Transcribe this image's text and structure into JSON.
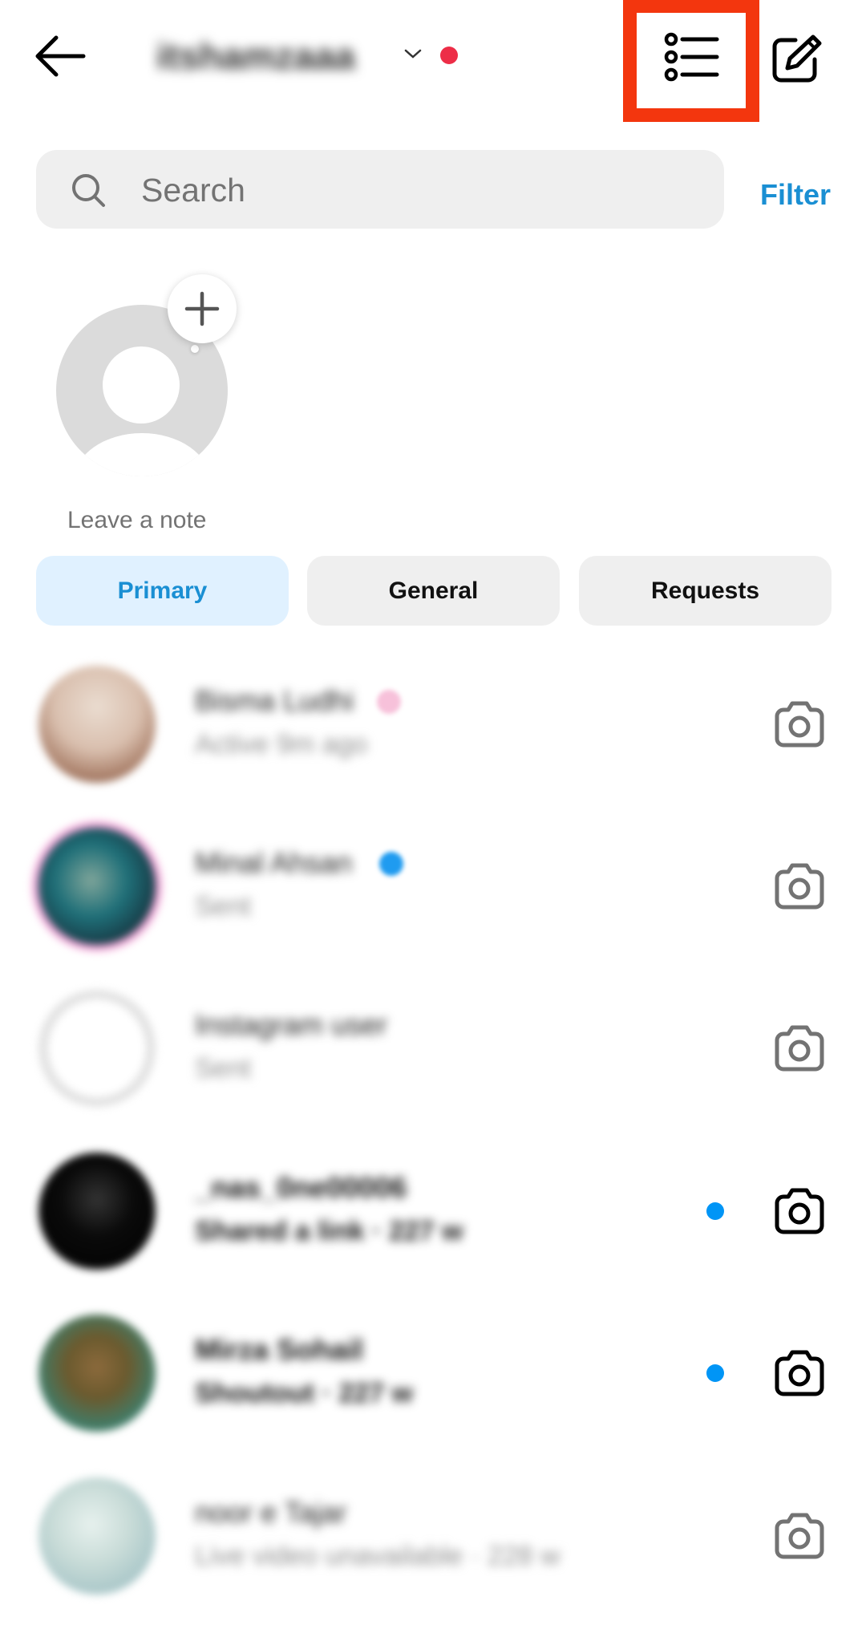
{
  "header": {
    "back_icon": "arrow-left-icon",
    "username": "itshamzaaa",
    "account_switch_icon": "chevron-down-icon",
    "notification_dot_color": "#ed2d47",
    "list_icon": "bulleted-list-icon",
    "highlight_color": "#f3360e",
    "compose_icon": "edit-square-icon"
  },
  "search": {
    "placeholder": "Search",
    "value": "",
    "filter_label": "Filter",
    "accent": "#1a8fd3"
  },
  "note": {
    "label": "Leave a note",
    "add_icon": "plus-icon"
  },
  "tabs": [
    {
      "label": "Primary",
      "active": true
    },
    {
      "label": "General",
      "active": false
    },
    {
      "label": "Requests",
      "active": false
    }
  ],
  "conversations": [
    {
      "name": "Bisma Ludhi",
      "subtitle": "Active 9m ago",
      "unread": false,
      "badge": "pink-heart"
    },
    {
      "name": "Minal Ahsan",
      "subtitle": "Sent",
      "unread": false,
      "badge": "verified-badge"
    },
    {
      "name": "Instagram user",
      "subtitle": "Sent",
      "unread": false,
      "badge": null
    },
    {
      "name": "_nas_0ne00006",
      "subtitle": "Shared a link · 227 w",
      "unread": true,
      "badge": null
    },
    {
      "name": "Mirza Sohail",
      "subtitle": "Shoutout · 227 w",
      "unread": true,
      "badge": null
    },
    {
      "name": "noor e Tajar",
      "subtitle": "Live video unavailable · 228 w",
      "unread": false,
      "badge": null
    }
  ],
  "colors": {
    "unread_dot": "#0095f6",
    "camera_read": "#737373",
    "camera_unread": "#000000"
  }
}
